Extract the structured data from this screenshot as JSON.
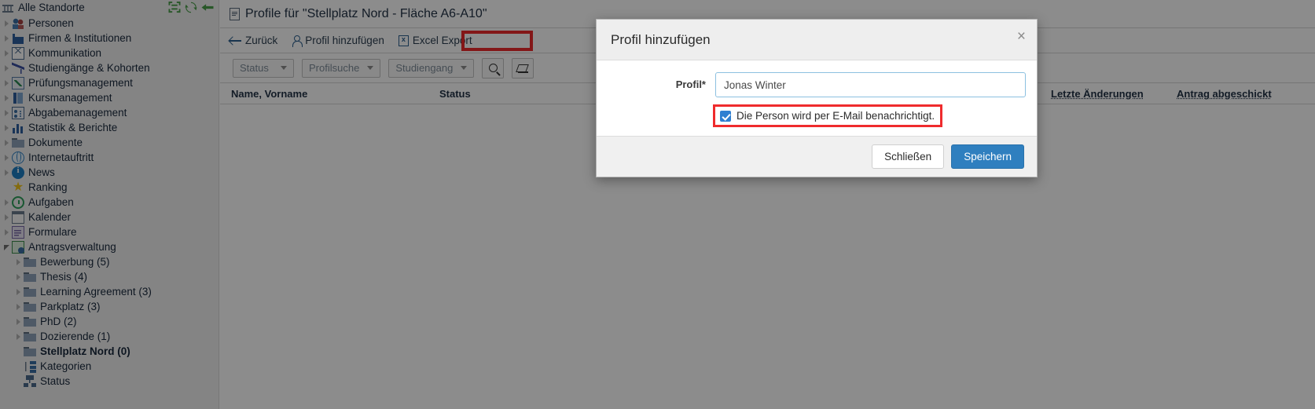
{
  "sidebar": {
    "root": {
      "label": "Alle Standorte",
      "icon": "bank-icon"
    },
    "top_actions": [
      {
        "name": "collapse-all-icon",
        "title": "Alle einklappen"
      },
      {
        "name": "refresh-icon",
        "title": "Aktualisieren"
      },
      {
        "name": "back-arrow-icon",
        "title": "Zurück"
      }
    ],
    "items": [
      {
        "label": "Personen",
        "icon": "people-icon",
        "expandable": true,
        "level": 1
      },
      {
        "label": "Firmen & Institutionen",
        "icon": "factory-icon",
        "expandable": true,
        "level": 1
      },
      {
        "label": "Kommunikation",
        "icon": "mail-icon",
        "expandable": true,
        "level": 1
      },
      {
        "label": "Studiengänge & Kohorten",
        "icon": "graduation-cap-icon",
        "expandable": true,
        "level": 1
      },
      {
        "label": "Prüfungsmanagement",
        "icon": "exam-icon",
        "expandable": true,
        "level": 1
      },
      {
        "label": "Kursmanagement",
        "icon": "book-icon",
        "expandable": true,
        "level": 1
      },
      {
        "label": "Abgabemanagement",
        "icon": "card-icon",
        "expandable": true,
        "level": 1
      },
      {
        "label": "Statistik & Berichte",
        "icon": "bar-chart-icon",
        "expandable": true,
        "level": 1
      },
      {
        "label": "Dokumente",
        "icon": "folder-icon",
        "expandable": true,
        "level": 1
      },
      {
        "label": "Internetauftritt",
        "icon": "globe-icon",
        "expandable": true,
        "level": 1
      },
      {
        "label": "News",
        "icon": "info-icon",
        "expandable": true,
        "level": 1
      },
      {
        "label": "Ranking",
        "icon": "star-icon",
        "expandable": false,
        "level": 1
      },
      {
        "label": "Aufgaben",
        "icon": "clock-icon",
        "expandable": true,
        "level": 1
      },
      {
        "label": "Kalender",
        "icon": "calendar-icon",
        "expandable": true,
        "level": 1
      },
      {
        "label": "Formulare",
        "icon": "form-icon",
        "expandable": true,
        "level": 1
      },
      {
        "label": "Antragsverwaltung",
        "icon": "antrag-icon",
        "expandable": true,
        "expanded": true,
        "level": 1
      },
      {
        "label": "Bewerbung (5)",
        "icon": "folder-icon",
        "expandable": true,
        "level": 2
      },
      {
        "label": "Thesis (4)",
        "icon": "folder-icon",
        "expandable": true,
        "level": 2
      },
      {
        "label": "Learning Agreement (3)",
        "icon": "folder-icon",
        "expandable": true,
        "level": 2
      },
      {
        "label": "Parkplatz (3)",
        "icon": "folder-icon",
        "expandable": true,
        "level": 2
      },
      {
        "label": "PhD (2)",
        "icon": "folder-icon",
        "expandable": true,
        "level": 2
      },
      {
        "label": "Dozierende (1)",
        "icon": "folder-icon",
        "expandable": true,
        "level": 2
      },
      {
        "label": "Stellplatz Nord (0)",
        "icon": "folder-icon",
        "expandable": false,
        "level": 2,
        "selected": true
      },
      {
        "label": "Kategorien",
        "icon": "categories-icon",
        "expandable": false,
        "level": 2
      },
      {
        "label": "Status",
        "icon": "status-icon",
        "expandable": false,
        "level": 2
      }
    ]
  },
  "main": {
    "page_title": "Profile für \"Stellplatz Nord - Fläche A6-A10\"",
    "toolbar": [
      {
        "label": "Zurück",
        "icon": "arrow-left-icon"
      },
      {
        "label": "Profil hinzufügen",
        "icon": "person-add-icon"
      },
      {
        "label": "Excel Export",
        "icon": "excel-icon"
      }
    ],
    "filters": [
      {
        "label": "Status",
        "name": "status-filter"
      },
      {
        "label": "Profilsuche",
        "name": "profilsuche-filter"
      },
      {
        "label": "Studiengang",
        "name": "studiengang-filter"
      }
    ],
    "filter_buttons": [
      {
        "name": "search-icon",
        "label": "Suchen"
      },
      {
        "name": "eraser-icon",
        "label": "Zurücksetzen"
      }
    ],
    "table": {
      "columns": [
        "Name, Vorname",
        "Status",
        "Letzte Änderungen",
        "Antrag abgeschickt"
      ],
      "rows": []
    }
  },
  "modal": {
    "title": "Profil hinzufügen",
    "close_label": "×",
    "field_label": "Profil*",
    "field_value": "Jonas Winter",
    "field_placeholder": "",
    "checkbox_label": "Die Person wird per E-Mail benachrichtigt.",
    "checkbox_checked": true,
    "buttons": {
      "close": "Schließen",
      "save": "Speichern"
    }
  },
  "highlights": {
    "color": "#ef2b2d",
    "regions": [
      "toolbar-empty-area",
      "email-notify-checkbox"
    ]
  }
}
